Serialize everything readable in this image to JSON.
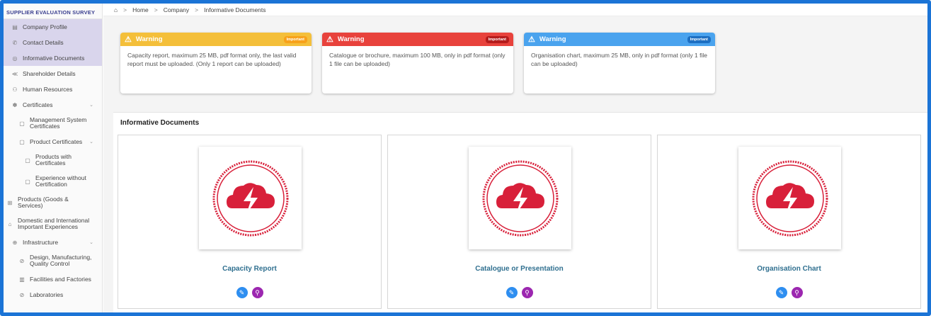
{
  "sidebar": {
    "title": "SUPPLIER EVALUATION SURVEY",
    "items": [
      {
        "label": "Company Profile",
        "icon": "building-icon",
        "glyph": "▤"
      },
      {
        "label": "Contact Details",
        "icon": "phone-icon",
        "glyph": "✆"
      },
      {
        "label": "Informative Documents",
        "icon": "document-icon",
        "glyph": "◎"
      },
      {
        "label": "Shareholder Details",
        "icon": "share-icon",
        "glyph": "≪"
      },
      {
        "label": "Human Resources",
        "icon": "people-icon",
        "glyph": "⚇"
      },
      {
        "label": "Certificates",
        "icon": "certificate-icon",
        "glyph": "✽"
      },
      {
        "label": "Management System Certificates",
        "icon": "file-icon",
        "glyph": "▢"
      },
      {
        "label": "Product Certificates",
        "icon": "file-icon",
        "glyph": "▢"
      },
      {
        "label": "Products with Certificates",
        "icon": "file-icon",
        "glyph": "▢"
      },
      {
        "label": "Experience without Certification",
        "icon": "file-icon",
        "glyph": "▢"
      },
      {
        "label": "Products (Goods & Services)",
        "icon": "grid-icon",
        "glyph": "⊞"
      },
      {
        "label": "Domestic and International Important Experiences",
        "icon": "briefcase-icon",
        "glyph": "⌂"
      },
      {
        "label": "Infrastructure",
        "icon": "globe-icon",
        "glyph": "⊕"
      },
      {
        "label": "Design, Manufacturing, Quality Control",
        "icon": "check-circle-icon",
        "glyph": "⊘"
      },
      {
        "label": "Facilities and Factories",
        "icon": "factory-icon",
        "glyph": "▥"
      },
      {
        "label": "Laboratories",
        "icon": "compass-icon",
        "glyph": "⊘"
      }
    ],
    "chevron_glyph": "⌄"
  },
  "breadcrumb": {
    "home_glyph": "⌂",
    "sep": ">",
    "items": [
      "Home",
      "Company",
      "Informative Documents"
    ]
  },
  "warnings": [
    {
      "title": "Warning",
      "badge": "Important",
      "text": "Capacity report, maximum 25 MB, pdf format only, the last valid report must be uploaded. (Only 1 report can be uploaded)",
      "color": "#f4bf3a"
    },
    {
      "title": "Warning",
      "badge": "Important",
      "text": "Catalogue or brochure, maximum 100 MB, only in pdf format (only 1 file can be uploaded)",
      "color": "#e8423c"
    },
    {
      "title": "Warning",
      "badge": "Important",
      "text": "Organisation chart, maximum 25 MB, only in pdf format (only 1 file can be uploaded)",
      "color": "#4aa3ee"
    }
  ],
  "warning_glyph": "⚠",
  "docs": {
    "title": "Informative Documents",
    "cards": [
      {
        "title": "Capacity Report"
      },
      {
        "title": "Catalogue or Presentation"
      },
      {
        "title": "Organisation Chart"
      }
    ],
    "edit_glyph": "✎",
    "view_glyph": "⚲",
    "accent": "#d8203a"
  }
}
